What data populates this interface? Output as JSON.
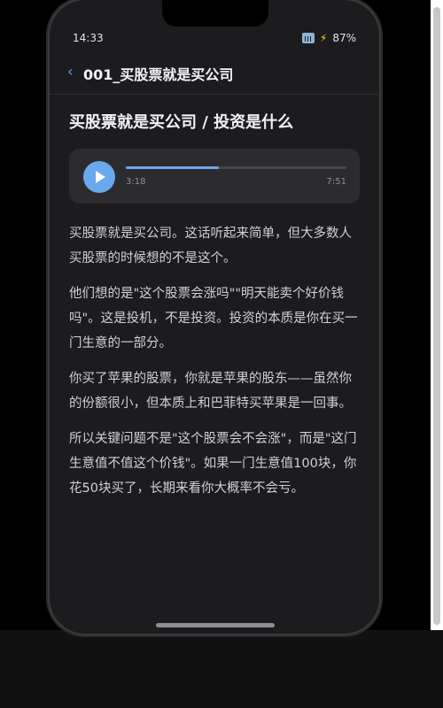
{
  "status_bar": {
    "time": "14:33",
    "battery": "87%",
    "icons": [
      "signal-icon",
      "bolt-icon"
    ]
  },
  "nav": {
    "back_icon": "‹",
    "title": "001_买股票就是买公司"
  },
  "article": {
    "title": "买股票就是买公司 / 投资是什么",
    "paragraphs": [
      "买股票就是买公司。这话听起来简单，但大多数人买股票的时候想的不是这个。",
      "他们想的是\"这个股票会涨吗\"\"明天能卖个好价钱吗\"。这是投机，不是投资。投资的本质是你在买一门生意的一部分。",
      "你买了苹果的股票，你就是苹果的股东——虽然你的份额很小，但本质上和巴菲特买苹果是一回事。",
      "所以关键问题不是\"这个股票会不会涨\"，而是\"这门生意值不值这个价钱\"。如果一门生意值100块，你花50块买了，长期来看你大概率不会亏。"
    ]
  },
  "player": {
    "current_time": "3:18",
    "total_time": "7:51",
    "progress_fraction": 0.42,
    "accent_color": "#6aa8ee",
    "play_icon": "play-icon"
  },
  "colors": {
    "background": "#1c1c1e",
    "accent": "#6aa8ee",
    "text": "#d1d1d6"
  }
}
